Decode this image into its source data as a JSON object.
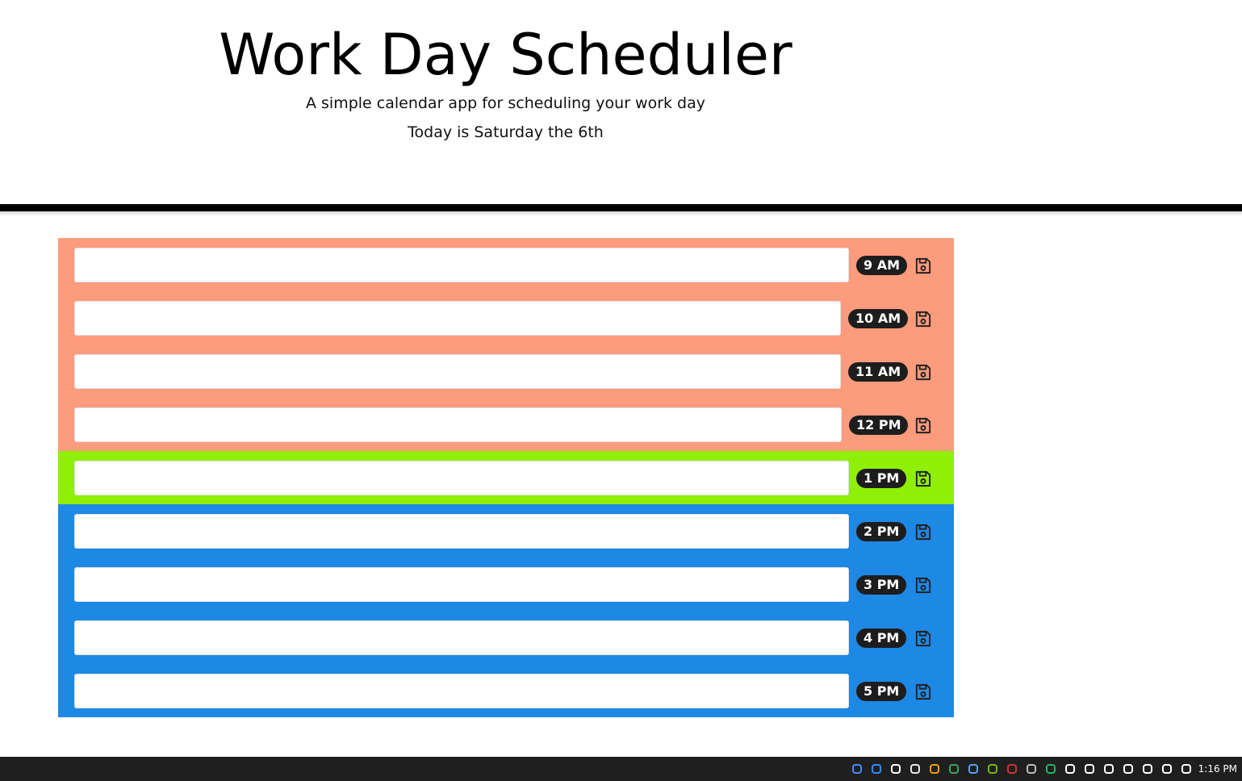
{
  "header": {
    "title": "Work Day Scheduler",
    "subtitle": "A simple calendar app for scheduling your work day",
    "current_day": "Today is Saturday the 6th"
  },
  "colors": {
    "past": "#fd9b7d",
    "present": "#8fef07",
    "future": "#1e88e5",
    "hour_badge": "#1d1d1d"
  },
  "time_blocks": [
    {
      "hour": "9 AM",
      "status": "past",
      "value": ""
    },
    {
      "hour": "10 AM",
      "status": "past",
      "value": ""
    },
    {
      "hour": "11 AM",
      "status": "past",
      "value": ""
    },
    {
      "hour": "12 PM",
      "status": "past",
      "value": ""
    },
    {
      "hour": "1 PM",
      "status": "present",
      "value": ""
    },
    {
      "hour": "2 PM",
      "status": "future",
      "value": ""
    },
    {
      "hour": "3 PM",
      "status": "future",
      "value": ""
    },
    {
      "hour": "4 PM",
      "status": "future",
      "value": ""
    },
    {
      "hour": "5 PM",
      "status": "future",
      "value": ""
    }
  ],
  "save_icon": "floppy-disk-icon",
  "taskbar": {
    "tray_icons": [
      "google-icon",
      "zoom-icon",
      "obs-icon",
      "slack-icon",
      "search-tool-icon",
      "wps-icon",
      "wacom-icon",
      "nvidia-icon",
      "red-app-icon",
      "keyboard-icon",
      "spotify-icon",
      "microphone-icon",
      "usb-icon",
      "defender-icon",
      "wifi-off-icon",
      "battery-icon",
      "network-icon",
      "volume-icon"
    ],
    "clock": "1:16 PM"
  }
}
